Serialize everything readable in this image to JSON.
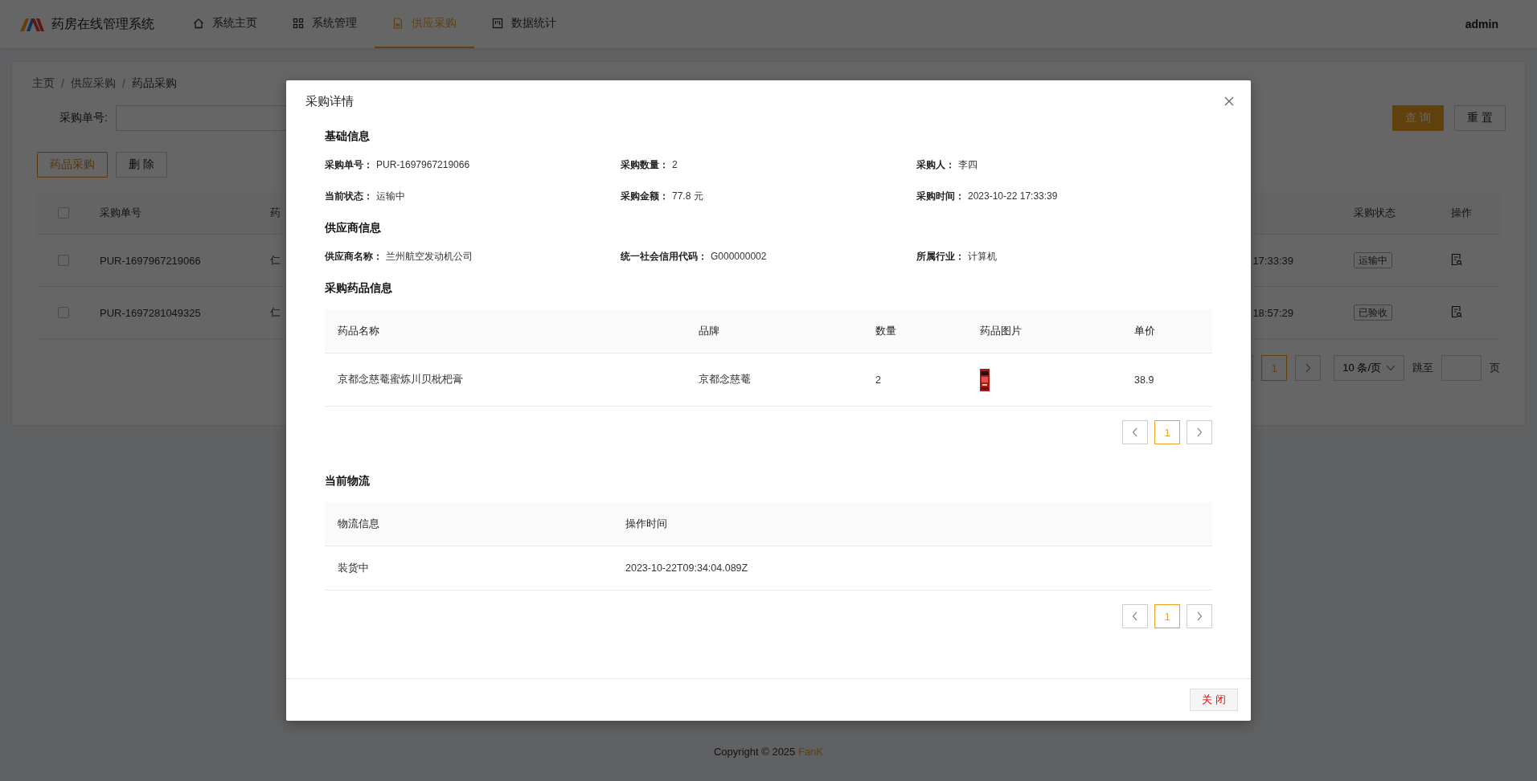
{
  "header": {
    "app_title": "药房在线管理系统",
    "nav": [
      {
        "label": "系统主页",
        "kind": "home",
        "selected": false
      },
      {
        "label": "系统管理",
        "kind": "grid",
        "selected": false
      },
      {
        "label": "供应采购",
        "kind": "document",
        "selected": true
      },
      {
        "label": "数据统计",
        "kind": "board",
        "selected": false
      }
    ],
    "user": "admin"
  },
  "breadcrumb": [
    "主页",
    "供应采购",
    "药品采购"
  ],
  "breadcrumb_separator": "/",
  "search": {
    "label": "采购单号:",
    "buttons": [
      {
        "label": "查 询",
        "kind": "primary"
      },
      {
        "label": "重 置",
        "kind": "default"
      }
    ]
  },
  "toolbar": [
    {
      "label": "药品采购",
      "kind": "outline"
    },
    {
      "label": "删 除",
      "kind": "default"
    }
  ],
  "table": {
    "header_checked": false,
    "columns": [
      "采购单号",
      "药",
      "采购状态",
      "操作"
    ],
    "rows": [
      {
        "checked": false,
        "order_no": "PUR-1697967219066",
        "column_3": "仁",
        "time": "17:33:39",
        "status": "运输中"
      },
      {
        "checked": false,
        "order_no": "PUR-1697281049325",
        "column_3": "仁",
        "time": "18:57:29",
        "status": "已验收"
      }
    ]
  },
  "pagination": {
    "current": "1",
    "page_size": "10 条/页",
    "jump_label": "跳至",
    "page_label": "页"
  },
  "footer": {
    "text": "Copyright © 2025",
    "author": "FanK"
  },
  "modal": {
    "title": "采购详情",
    "sections": [
      {
        "heading": "基础信息",
        "fields": [
          {
            "label": "采购单号：",
            "value": "PUR-1697967219066"
          },
          {
            "label": "采购数量：",
            "value": "2"
          },
          {
            "label": "采购人：",
            "value": "李四"
          },
          {
            "label": "当前状态：",
            "value": "运输中"
          },
          {
            "label": "采购金额：",
            "value": "77.8 元"
          },
          {
            "label": "采购时间：",
            "value": "2023-10-22 17:33:39"
          }
        ]
      },
      {
        "heading": "供应商信息",
        "fields": [
          {
            "label": "供应商名称：",
            "value": "兰州航空发动机公司"
          },
          {
            "label": "统一社会信用代码：",
            "value": "G000000002"
          },
          {
            "label": "所属行业：",
            "value": "计算机"
          }
        ]
      }
    ],
    "goods": {
      "heading": "采购药品信息",
      "columns": [
        "药品名称",
        "品牌",
        "数量",
        "药品图片",
        "单价"
      ],
      "rows": [
        {
          "name": "京都念慈菴蜜炼川贝枇杷膏",
          "brand": "京都念慈菴",
          "quantity": "2",
          "price": "38.9"
        }
      ],
      "current_page": "1"
    },
    "logistics": {
      "heading": "当前物流",
      "columns": [
        "物流信息",
        "操作时间"
      ],
      "rows": [
        {
          "info": "装货中",
          "time": "2023-10-22T09:34:04.089Z"
        }
      ],
      "current_page": "1"
    },
    "close_button": "关 闭"
  }
}
